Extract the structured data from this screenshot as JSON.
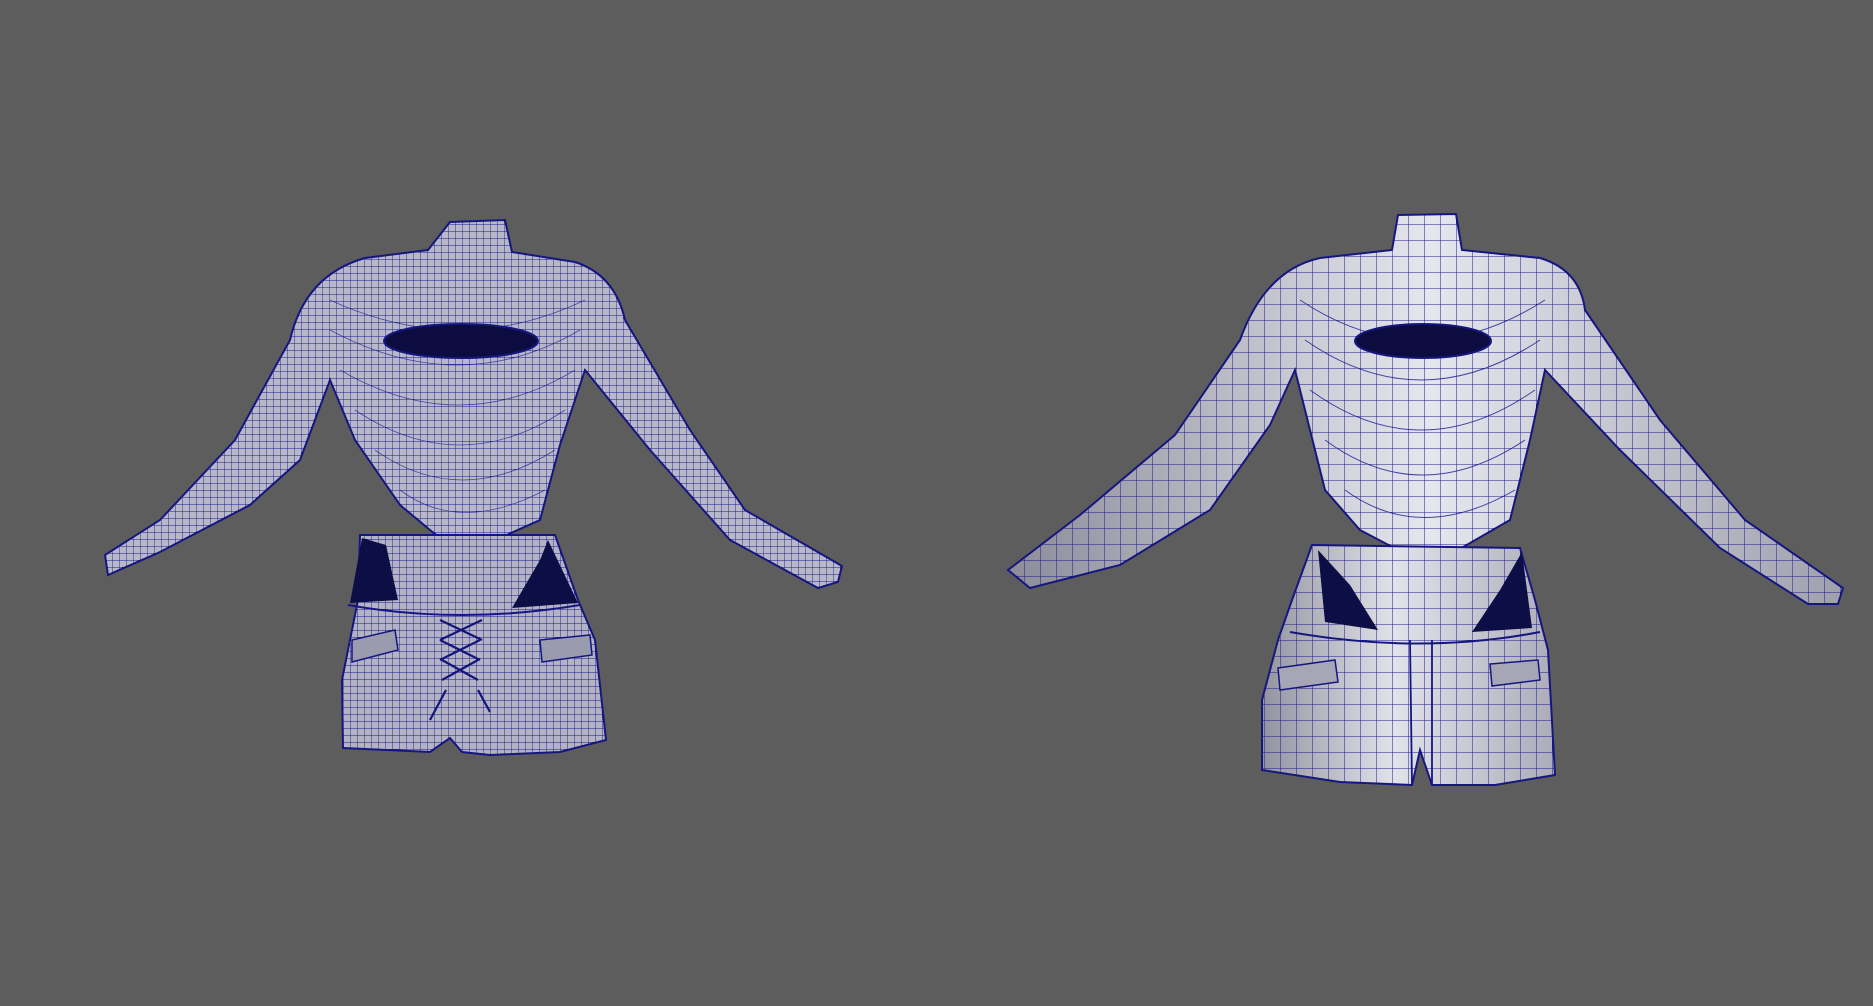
{
  "viewport": {
    "background_color": "#5d5d5d",
    "wire_color": "#14148c",
    "hole_color": "#0a0a3a",
    "surface_color": "#c9c9d4",
    "surface_highlight": "#ececf2",
    "surface_shadow": "#8a8a96"
  },
  "models": [
    {
      "id": "highpoly",
      "label": "",
      "description_icon": "garment-mesh-icon"
    },
    {
      "id": "lowpoly",
      "label": "",
      "description_icon": "garment-mesh-icon"
    }
  ]
}
